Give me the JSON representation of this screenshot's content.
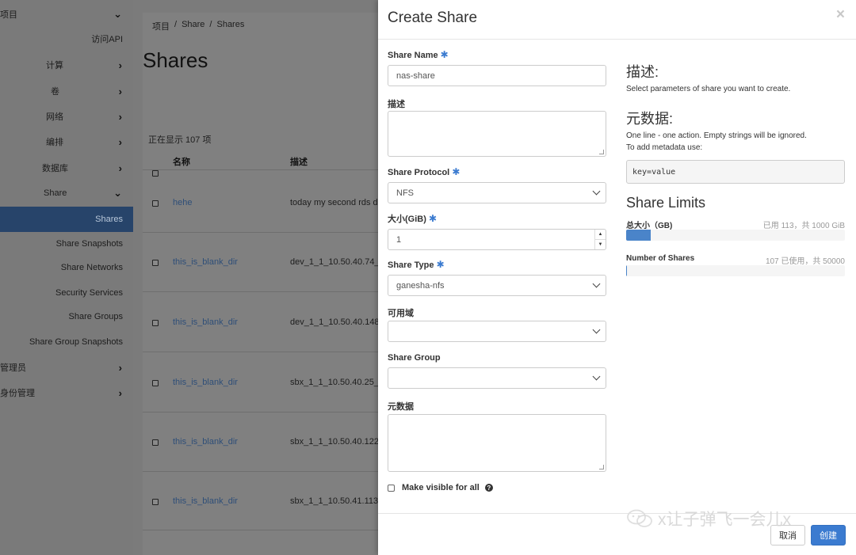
{
  "sidebar": {
    "items": [
      {
        "label": "项目",
        "chevron": "down"
      },
      {
        "label": "访问API",
        "chevron": ""
      },
      {
        "label": "计算",
        "chevron": "right"
      },
      {
        "label": "卷",
        "chevron": "right"
      },
      {
        "label": "网络",
        "chevron": "right"
      },
      {
        "label": "编排",
        "chevron": "right"
      },
      {
        "label": "数据库",
        "chevron": "right"
      },
      {
        "label": "Share",
        "chevron": "down"
      },
      {
        "label": "Shares",
        "chevron": ""
      },
      {
        "label": "Share Snapshots",
        "chevron": ""
      },
      {
        "label": "Share Networks",
        "chevron": ""
      },
      {
        "label": "Security Services",
        "chevron": ""
      },
      {
        "label": "Share Groups",
        "chevron": ""
      },
      {
        "label": "Share Group Snapshots",
        "chevron": ""
      },
      {
        "label": "管理员",
        "chevron": "right"
      },
      {
        "label": "身份管理",
        "chevron": "right"
      }
    ],
    "chevron_right": "›",
    "chevron_down": "⌄"
  },
  "breadcrumb": [
    "项目",
    "/",
    "Share",
    "/",
    "Shares"
  ],
  "page": {
    "title": "Shares",
    "count_text": "正在显示 107 项",
    "columns": [
      "名称",
      "描述"
    ]
  },
  "table": {
    "rows": [
      {
        "name": "hehe",
        "desc": "today my second rds d"
      },
      {
        "name": "this_is_blank_dir",
        "desc": "dev_1_1_10.50.40.74_"
      },
      {
        "name": "this_is_blank_dir",
        "desc": "dev_1_1_10.50.40.148_"
      },
      {
        "name": "this_is_blank_dir",
        "desc": "sbx_1_1_10.50.40.25_"
      },
      {
        "name": "this_is_blank_dir",
        "desc": "sbx_1_1_10.50.40.122_"
      },
      {
        "name": "this_is_blank_dir",
        "desc": "sbx_1_1_10.50.41.113_"
      }
    ]
  },
  "modal": {
    "title": "Create Share",
    "close": "×",
    "required_mark": "✱",
    "fields": {
      "share_name_label": "Share Name",
      "share_name_value": "nas-share",
      "desc_label": "描述",
      "protocol_label": "Share Protocol",
      "protocol_value": "NFS",
      "size_label": "大小(GiB)",
      "size_value": "1",
      "type_label": "Share Type",
      "type_value": "ganesha-nfs",
      "az_label": "可用域",
      "az_value": "",
      "group_label": "Share Group",
      "group_value": "",
      "metadata_label": "元数据",
      "visible_label": "Make visible for all",
      "help_glyph": "?",
      "spin_up": "▲",
      "spin_down": "▼"
    },
    "help": {
      "desc_heading": "描述:",
      "desc_text": "Select parameters of share you want to create.",
      "meta_heading": "元数据:",
      "meta_text_1": "One line - one action. Empty strings will be ignored.",
      "meta_text_2": "To add metadata use:",
      "meta_example": "key=value"
    },
    "limits": {
      "heading": "Share Limits",
      "size_label": "总大小（GB)",
      "size_stat": "已用 113，共 1000 GiB",
      "size_used": 113,
      "size_total": 1000,
      "count_label": "Number of Shares",
      "count_stat": "107 已使用，共 50000",
      "count_used": 107,
      "count_total": 50000
    },
    "buttons": {
      "cancel": "取消",
      "create": "创建"
    }
  },
  "watermark": "x让子弹飞一会儿x",
  "colors": {
    "accent": "#3b7bd0",
    "sidebar_active": "#27446a",
    "link": "#2e4e78"
  }
}
